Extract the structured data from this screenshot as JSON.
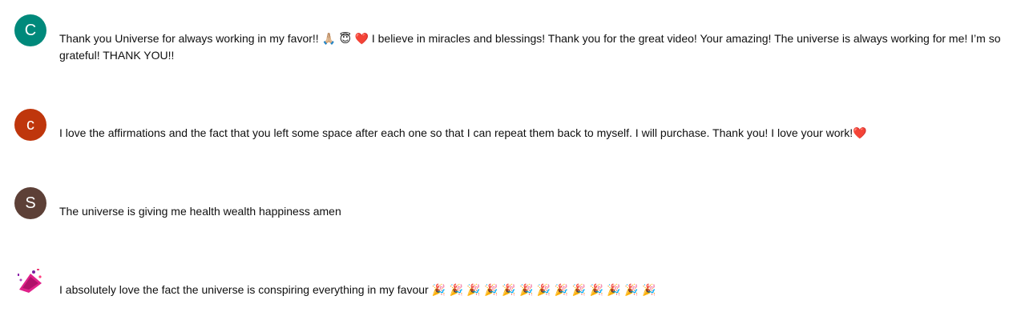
{
  "comments": [
    {
      "avatar_letter": "C",
      "avatar_color": "#00897b",
      "text_before": "Thank you Universe for always working in my favor!! ",
      "emoji_1": "🙏🏼 😇 ",
      "heart": "❤️",
      "text_after": " I believe in miracles and blessings! Thank you for the great video! Your amazing!  The universe is always working for me! I’m so grateful! THANK YOU!!"
    },
    {
      "avatar_letter": "c",
      "avatar_color": "#bf360c",
      "text": "I love the affirmations and the fact that you left some space after each one so that I can repeat them back to myself. I will purchase. Thank you! I love your work!",
      "heart": "❤️"
    },
    {
      "avatar_letter": "S",
      "avatar_color": "#5d4037",
      "text": "The universe is giving me health wealth happiness amen"
    },
    {
      "avatar_icon": "party-popper-avatar",
      "text": "I absolutely love the fact the universe is conspiring everything in my favour ",
      "emojis": "🎉 🎉 🎉 🎉 🎉 🎉 🎉 🎉 🎉 🎉 🎉 🎉 🎉"
    }
  ]
}
